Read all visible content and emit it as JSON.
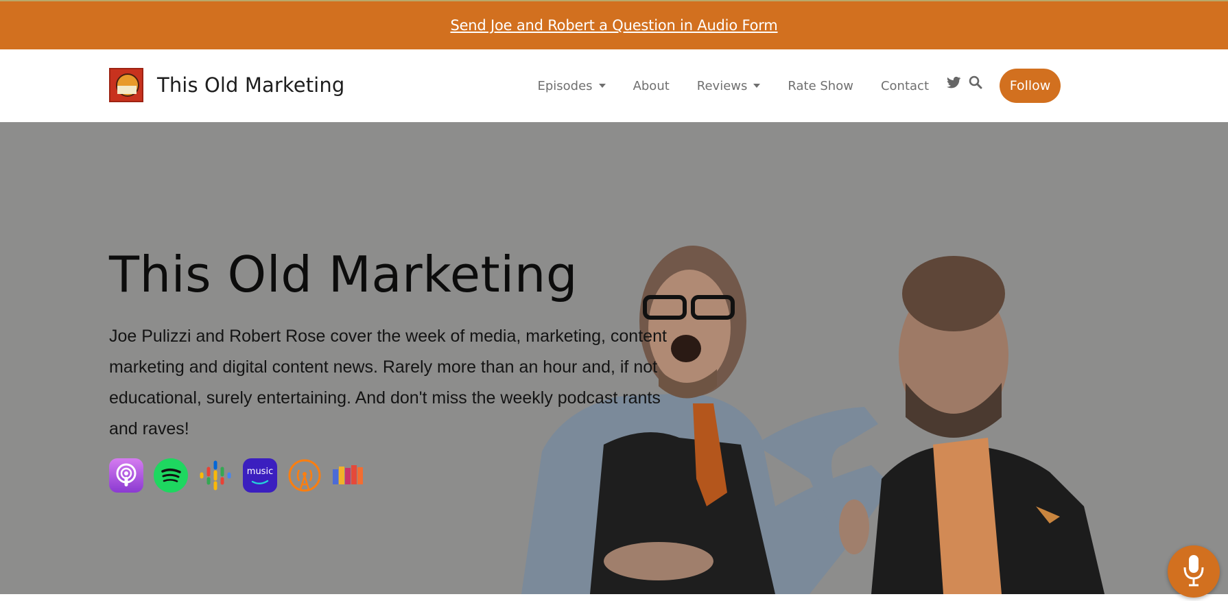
{
  "banner": {
    "link_text": "Send Joe and Robert a Question in Audio Form"
  },
  "header": {
    "brand_name": "This Old Marketing",
    "logo_text": "THIS OLD MARKETING",
    "nav": [
      {
        "label": "Episodes",
        "dropdown": true
      },
      {
        "label": "About",
        "dropdown": false
      },
      {
        "label": "Reviews",
        "dropdown": true
      },
      {
        "label": "Rate Show",
        "dropdown": false
      },
      {
        "label": "Contact",
        "dropdown": false
      }
    ],
    "icons": [
      "twitter-icon",
      "search-icon"
    ],
    "follow_label": "Follow"
  },
  "hero": {
    "title": "This Old Marketing",
    "description": "Joe Pulizzi and Robert Rose cover the week of media, marketing, content marketing and digital content news. Rarely more than an hour and, if not educational, surely entertaining. And don't miss the weekly podcast rants and raves!",
    "platforms": [
      {
        "name": "apple-podcasts-icon",
        "color": "#a94ee0"
      },
      {
        "name": "spotify-icon",
        "color": "#1ed760"
      },
      {
        "name": "google-podcasts-icon",
        "color": "#4285f4"
      },
      {
        "name": "amazon-music-icon",
        "color": "#3b1fbf",
        "text": "music"
      },
      {
        "name": "overcast-icon",
        "color": "#fc7e0f"
      },
      {
        "name": "podchaser-icon",
        "color": "#e5493a"
      }
    ]
  },
  "colors": {
    "accent": "#d2701f",
    "hero_bg": "#8d8d8c",
    "nav_text": "#6f6f6f"
  }
}
